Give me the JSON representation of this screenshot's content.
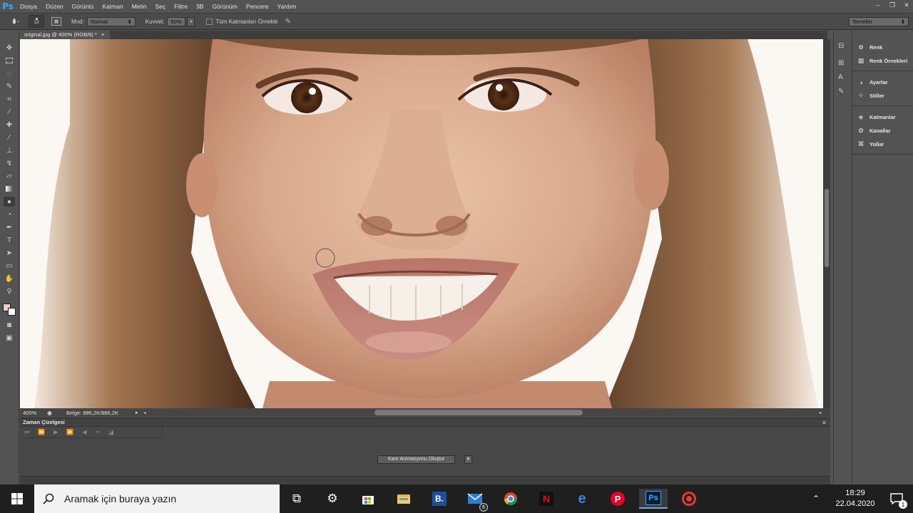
{
  "app": {
    "logo": "Ps"
  },
  "menu": [
    "Dosya",
    "Düzen",
    "Görüntü",
    "Katman",
    "Metin",
    "Seç",
    "Filtre",
    "3B",
    "Görünüm",
    "Pencere",
    "Yardım"
  ],
  "window_controls": {
    "minimize": "–",
    "restore": "❐",
    "close": "✕"
  },
  "options": {
    "brush_size": "13",
    "mode_label": "Mod:",
    "mode_value": "Normal",
    "strength_label": "Kuvvet:",
    "strength_value": "50%",
    "sample_all_label": "Tüm Katmanları Örnekle",
    "workspace": "Temeller"
  },
  "document": {
    "tab_title": "original.jpg @ 400% (RGB/8) *",
    "close": "×"
  },
  "status": {
    "zoom": "400%",
    "doc_info": "Belge: 886,2K/886,2K"
  },
  "timeline": {
    "title": "Zaman Çizelgesi",
    "create_button": "Kare Animasyonu Oluştur"
  },
  "panels": {
    "group1": [
      "Renk",
      "Renk Örnekleri"
    ],
    "group2": [
      "Ayarlar",
      "Stiller"
    ],
    "group3": [
      "Katmanlar",
      "Kanallar",
      "Yollar"
    ]
  },
  "taskbar": {
    "search_placeholder": "Aramak için buraya yazın",
    "time": "18:29",
    "date": "22.04.2020",
    "mail_badge": "6",
    "notification_badge": "1"
  },
  "colors": {
    "foreground": "#ebd0c0",
    "background": "#ffffff",
    "ps_blue": "#31a8ff"
  }
}
